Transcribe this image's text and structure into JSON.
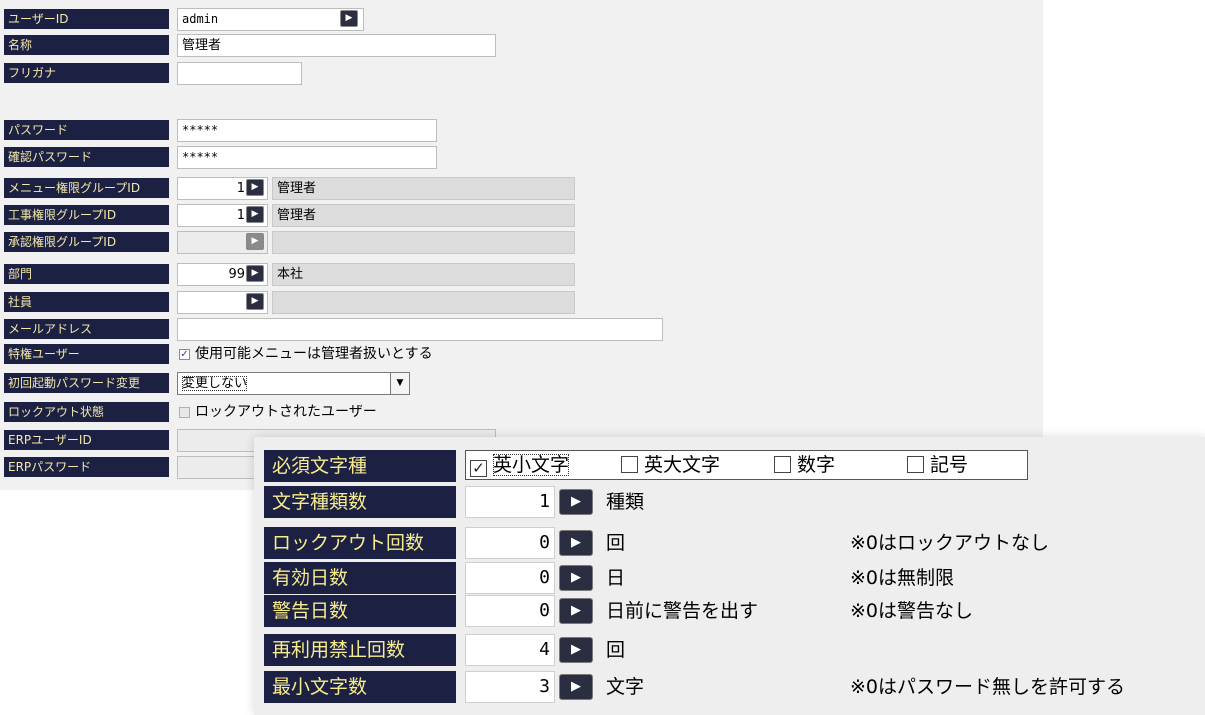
{
  "form": {
    "user_id": {
      "label": "ユーザーID",
      "value": "admin"
    },
    "name": {
      "label": "名称",
      "value": "管理者"
    },
    "furigana": {
      "label": "フリガナ",
      "value": ""
    },
    "password": {
      "label": "パスワード",
      "value": "*****"
    },
    "confirm_password": {
      "label": "確認パスワード",
      "value": "*****"
    },
    "menu_group": {
      "label": "メニュー権限グループID",
      "value": "1",
      "name": "管理者"
    },
    "work_group": {
      "label": "工事権限グループID",
      "value": "1",
      "name": "管理者"
    },
    "approval_group": {
      "label": "承認権限グループID",
      "value": "",
      "name": ""
    },
    "department": {
      "label": "部門",
      "value": "99",
      "name": "本社"
    },
    "employee": {
      "label": "社員",
      "value": "",
      "name": ""
    },
    "email": {
      "label": "メールアドレス",
      "value": ""
    },
    "privileged": {
      "label": "特権ユーザー",
      "checkbox_label": "使用可能メニューは管理者扱いとする",
      "checked": true
    },
    "first_login_pw_change": {
      "label": "初回起動パスワード変更",
      "selected": "変更しない"
    },
    "lockout_status": {
      "label": "ロックアウト状態",
      "checkbox_label": "ロックアウトされたユーザー",
      "checked": false
    },
    "erp_user_id": {
      "label": "ERPユーザーID",
      "value": ""
    },
    "erp_password": {
      "label": "ERPパスワード",
      "value": ""
    }
  },
  "policy": {
    "required_chars": {
      "label": "必須文字種",
      "options": [
        {
          "label": "英小文字",
          "checked": true
        },
        {
          "label": "英大文字",
          "checked": false
        },
        {
          "label": "数字",
          "checked": false
        },
        {
          "label": "記号",
          "checked": false
        }
      ]
    },
    "char_type_count": {
      "label": "文字種類数",
      "value": "1",
      "unit": "種類",
      "note": ""
    },
    "lockout_count": {
      "label": "ロックアウト回数",
      "value": "0",
      "unit": "回",
      "note": "※0はロックアウトなし"
    },
    "valid_days": {
      "label": "有効日数",
      "value": "0",
      "unit": "日",
      "note": "※0は無制限"
    },
    "warning_days": {
      "label": "警告日数",
      "value": "0",
      "unit": "日前に警告を出す",
      "note": "※0は警告なし"
    },
    "reuse_prohibit": {
      "label": "再利用禁止回数",
      "value": "4",
      "unit": "回",
      "note": ""
    },
    "min_length": {
      "label": "最小文字数",
      "value": "3",
      "unit": "文字",
      "note": "※0はパスワード無しを許可する"
    }
  },
  "icons": {
    "lookup": "arrow-right-icon",
    "dropdown": "chevron-down-icon",
    "checkbox": "checkbox-icon"
  }
}
